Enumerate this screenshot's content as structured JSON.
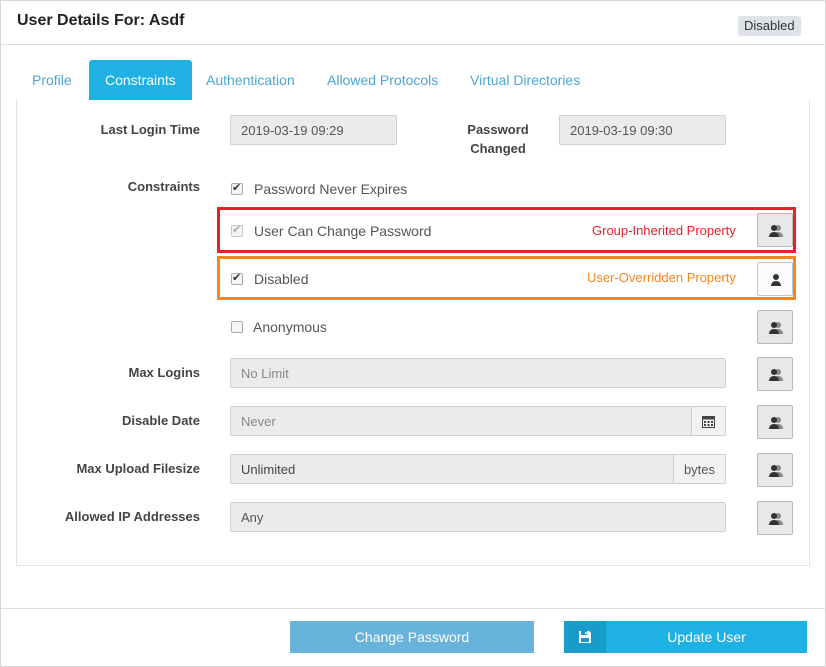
{
  "header": {
    "title": "User Details For: Asdf",
    "status_badge": "Disabled"
  },
  "tabs": [
    {
      "label": "Profile",
      "active": false
    },
    {
      "label": "Constraints",
      "active": true
    },
    {
      "label": "Authentication",
      "active": false
    },
    {
      "label": "Allowed Protocols",
      "active": false
    },
    {
      "label": "Virtual Directories",
      "active": false
    }
  ],
  "form": {
    "last_login": {
      "label": "Last Login Time",
      "value": "2019-03-19 09:29"
    },
    "password_changed": {
      "label_line1": "Password",
      "label_line2": "Changed",
      "value": "2019-03-19 09:30"
    },
    "constraints": {
      "label": "Constraints",
      "password_never_expires": {
        "label": "Password Never Expires",
        "checked": true
      },
      "user_can_change_password": {
        "label": "User Can Change Password",
        "checked": true,
        "note": "Group-Inherited Property"
      },
      "disabled": {
        "label": "Disabled",
        "checked": true,
        "note": "User-Overridden Property"
      },
      "anonymous": {
        "label": "Anonymous",
        "checked": false
      }
    },
    "max_logins": {
      "label": "Max Logins",
      "placeholder": "No Limit"
    },
    "disable_date": {
      "label": "Disable Date",
      "placeholder": "Never",
      "icon": "calendar-icon"
    },
    "max_upload_filesize": {
      "label": "Max Upload Filesize",
      "value": "Unlimited",
      "unit": "bytes"
    },
    "allowed_ip_addresses": {
      "label": "Allowed IP Addresses",
      "placeholder": "Any"
    }
  },
  "buttons": {
    "change_password": "Change Password",
    "update_user": "Update User"
  },
  "colors": {
    "accent": "#1fb1e3",
    "group_inherited": "#e8202a",
    "user_overridden": "#f5851f"
  }
}
